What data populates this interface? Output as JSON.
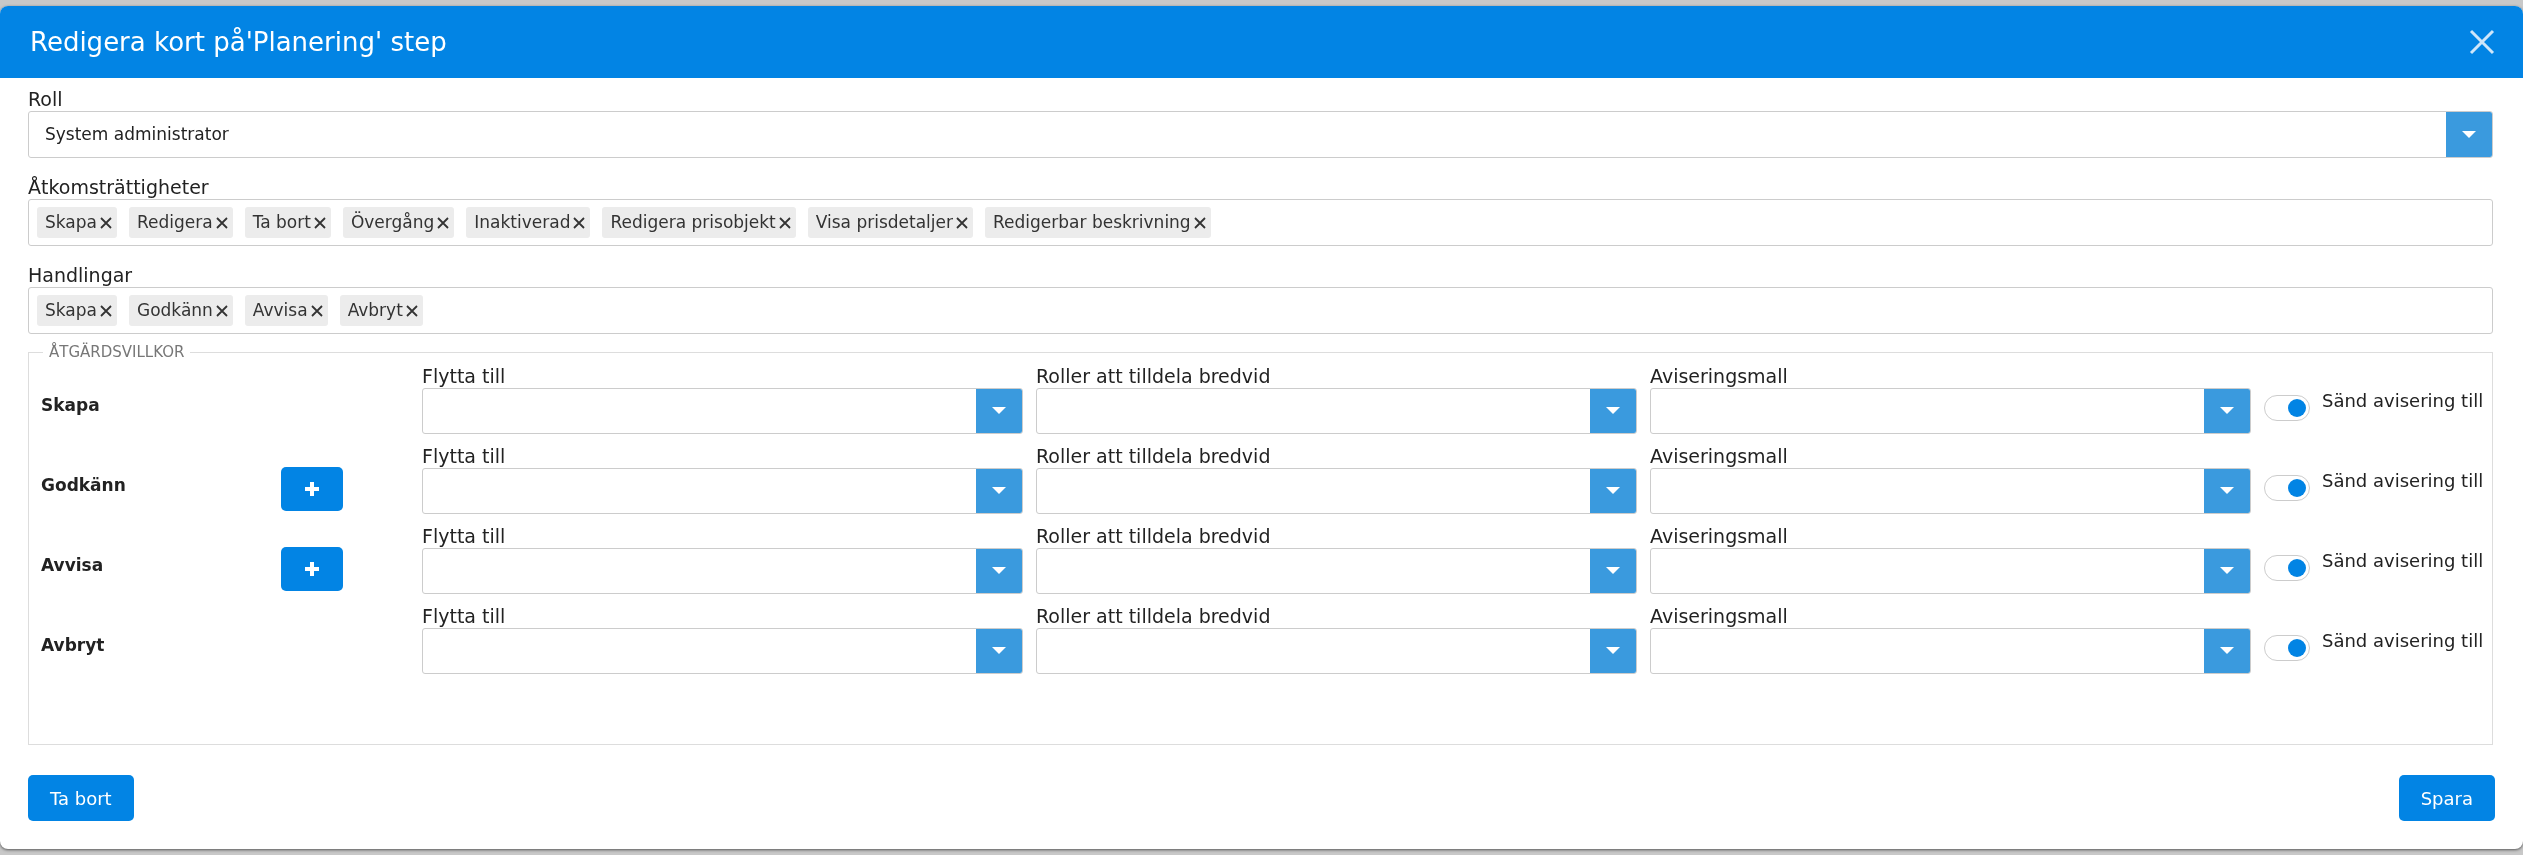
{
  "dialog": {
    "title": "Redigera kort på'Planering' step"
  },
  "fields": [
    {
      "kind": "select",
      "label": "Roll",
      "value": "System administrator"
    },
    {
      "kind": "tags",
      "label": "Åtkomsträttigheter",
      "tags": [
        "Skapa",
        "Redigera",
        "Ta bort",
        "Övergång",
        "Inaktiverad",
        "Redigera prisobjekt",
        "Visa prisdetaljer",
        "Redigerbar beskrivning"
      ]
    },
    {
      "kind": "tags",
      "label": "Handlingar",
      "tags": [
        "Skapa",
        "Godkänn",
        "Avvisa",
        "Avbryt"
      ]
    }
  ],
  "conditions": {
    "legend": "ÅTGÄRDSVILLKOR",
    "rows": [
      {
        "action": "Skapa",
        "add_button": false,
        "move_label": "Flytta till",
        "roles_label": "Roller att tilldela bredvid",
        "template_label": "Aviseringsmall",
        "notify": {
          "label": "Sänd avisering till",
          "on": true
        }
      },
      {
        "action": "Godkänn",
        "add_button": true,
        "move_label": "Flytta till",
        "roles_label": "Roller att tilldela bredvid",
        "template_label": "Aviseringsmall",
        "notify": {
          "label": "Sänd avisering till",
          "on": true
        }
      },
      {
        "action": "Avvisa",
        "add_button": true,
        "move_label": "Flytta till",
        "roles_label": "Roller att tilldela bredvid",
        "template_label": "Aviseringsmall",
        "notify": {
          "label": "Sänd avisering till",
          "on": true
        }
      },
      {
        "action": "Avbryt",
        "add_button": false,
        "move_label": "Flytta till",
        "roles_label": "Roller att tilldela bredvid",
        "template_label": "Aviseringsmall",
        "notify": {
          "label": "Sänd avisering till",
          "on": true
        }
      }
    ]
  },
  "footer": {
    "delete": "Ta bort",
    "save": "Spara"
  }
}
